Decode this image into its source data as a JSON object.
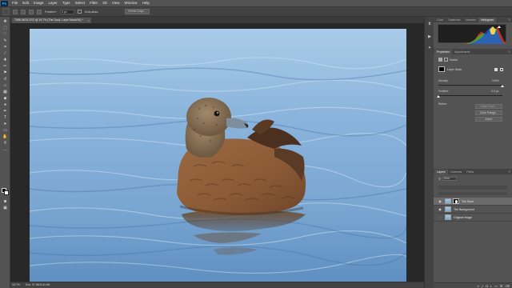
{
  "app": {
    "logo": "Ps"
  },
  "menu": [
    "File",
    "Edit",
    "Image",
    "Layer",
    "Type",
    "Select",
    "Filter",
    "3D",
    "View",
    "Window",
    "Help"
  ],
  "options": {
    "feather_label": "Feather:",
    "feather_value": "0 px",
    "antialias_label": "Anti-alias",
    "refine_button": "Refine Edge..."
  },
  "document": {
    "tab_title": "7688-WG5.CR2 @ 16.7% (The Duck, Layer Mask/16) *",
    "close": "×"
  },
  "status": {
    "zoom": "16.7%",
    "doc_size": "Doc: 57.8M/140.4M"
  },
  "top_panel": {
    "tabs": [
      "Color",
      "Swatches",
      "Libraries",
      "Histogram"
    ],
    "active": "Histogram"
  },
  "properties": {
    "tabs": [
      "Properties",
      "Adjustments"
    ],
    "title": "Masks",
    "mask_label": "Layer Mask",
    "density_label": "Density:",
    "density_value": "100%",
    "density": 1.0,
    "feather_label": "Feather:",
    "feather_value": "0.0 px",
    "feather": 0.0,
    "refine_label": "Refine:",
    "mask_edge_button": "Mask Edge...",
    "color_range_button": "Color Range...",
    "invert_button": "Invert"
  },
  "layers_panel": {
    "tabs": [
      "Layers",
      "Channels",
      "Paths"
    ],
    "kind_label": "Kind",
    "layers": [
      {
        "name": "The Duck",
        "selected": true,
        "has_mask": true
      },
      {
        "name": "The Background",
        "selected": false,
        "has_mask": false
      },
      {
        "name": "Original Image",
        "selected": false,
        "has_mask": false
      }
    ],
    "footer_icons": [
      "link-icon",
      "fx-icon",
      "mask-icon",
      "adjustment-icon",
      "folder-icon",
      "new-layer-icon",
      "trash-icon"
    ]
  },
  "colors": {
    "foreground": "#000000",
    "background": "#ffffff",
    "accent": "#31a8ff"
  }
}
